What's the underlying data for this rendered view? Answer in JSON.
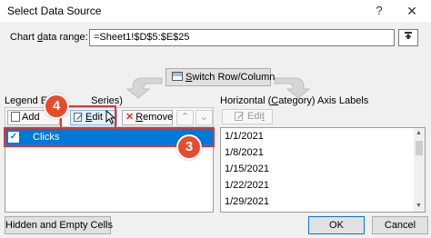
{
  "window": {
    "title": "Select Data Source",
    "help": "?",
    "close": "✕"
  },
  "range": {
    "label_pre": "Chart ",
    "label_u": "d",
    "label_post": "ata range:",
    "value": "=Sheet1!$D$5:$E$25"
  },
  "switch_button": {
    "pre": "",
    "u": "S",
    "post": "witch Row/Column"
  },
  "legend": {
    "header_visible_left": "Legend E",
    "header_visible_right": "Series)",
    "add_pre": "Add",
    "edit_u": "E",
    "edit_post": "dit",
    "remove_pre": "",
    "remove_u": "R",
    "remove_post": "emove",
    "items": [
      {
        "label": "Clicks",
        "checked": true
      }
    ]
  },
  "axis": {
    "header_pre": "Horizontal (",
    "header_u": "C",
    "header_post": "ategory) Axis Labels",
    "edit_pre": "Edi",
    "edit_u": "t",
    "items": [
      "1/1/2021",
      "1/8/2021",
      "1/15/2021",
      "1/22/2021",
      "1/29/2021"
    ]
  },
  "footer": {
    "hidden_label": "Hidden and Empty Cells",
    "ok_label": "OK",
    "cancel_label": "Cancel"
  },
  "callouts": {
    "badge_4": "4",
    "badge_3": "3"
  },
  "colors": {
    "highlight": "#e3342f",
    "selection": "#0078d7",
    "badge": "#e84a2c"
  }
}
